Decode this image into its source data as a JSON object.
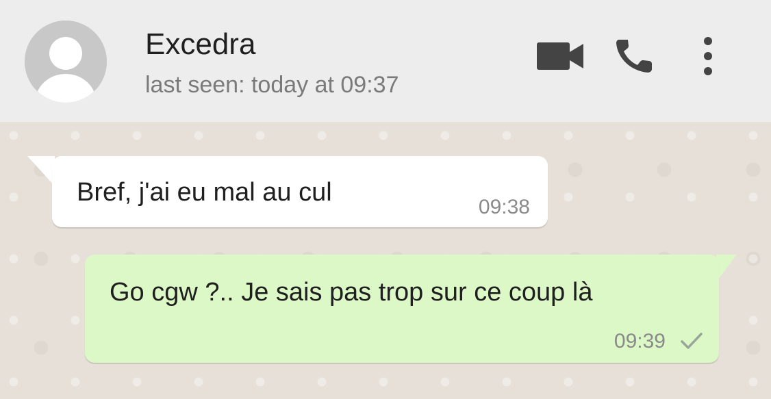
{
  "header": {
    "contact_name": "Excedra",
    "status": "last seen: today at 09:37",
    "icons": [
      "avatar-placeholder-icon",
      "video-call-icon",
      "voice-call-icon",
      "more-options-icon"
    ]
  },
  "messages": [
    {
      "direction": "incoming",
      "text": "Bref, j'ai eu mal au cul",
      "time": "09:38"
    },
    {
      "direction": "outgoing",
      "text": "Go cgw ?.. Je sais pas trop sur ce coup là",
      "time": "09:39",
      "status_icon": "sent-check-icon"
    }
  ],
  "colors": {
    "header_bg": "#ededed",
    "chat_bg": "#e7e0d8",
    "incoming_bubble": "#ffffff",
    "outgoing_bubble": "#dcf8c6",
    "icon": "#444444"
  }
}
